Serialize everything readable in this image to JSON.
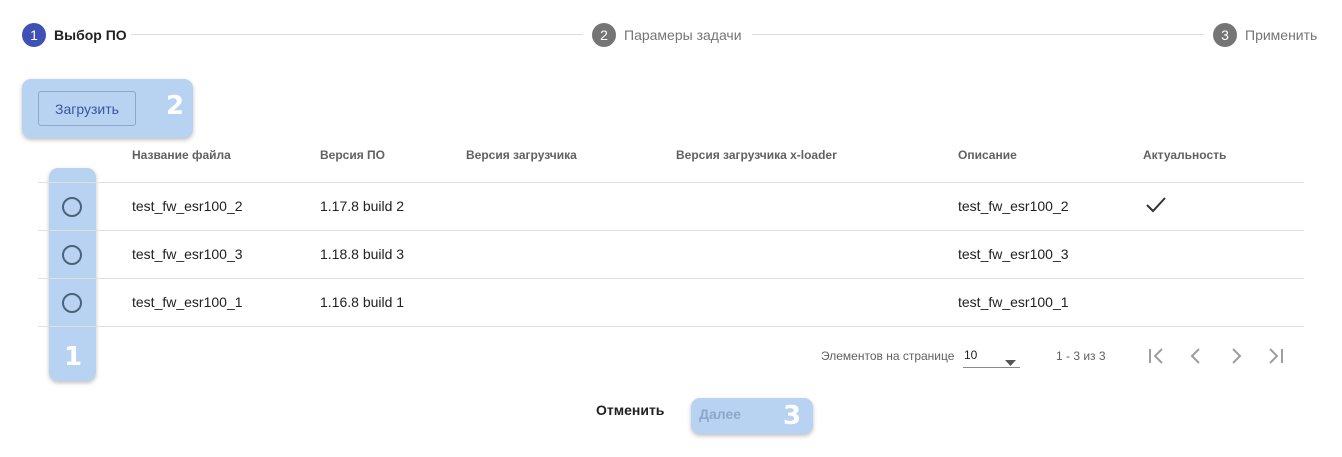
{
  "stepper": {
    "steps": [
      {
        "num": "1",
        "label": "Выбор ПО",
        "active": true
      },
      {
        "num": "2",
        "label": "Парамеры задачи",
        "active": false
      },
      {
        "num": "3",
        "label": "Применить",
        "active": false
      }
    ]
  },
  "toolbar": {
    "upload_label": "Загрузить"
  },
  "table": {
    "columns": [
      "Название файла",
      "Версия ПО",
      "Версия загрузчика",
      "Версия загрузчика x-loader",
      "Описание",
      "Актуальность"
    ],
    "rows": [
      {
        "file": "test_fw_esr100_2",
        "version": "1.17.8 build 2",
        "loader": "",
        "xloader": "",
        "description": "test_fw_esr100_2",
        "actual": true
      },
      {
        "file": "test_fw_esr100_3",
        "version": "1.18.8 build 3",
        "loader": "",
        "xloader": "",
        "description": "test_fw_esr100_3",
        "actual": false
      },
      {
        "file": "test_fw_esr100_1",
        "version": "1.16.8 build 1",
        "loader": "",
        "xloader": "",
        "description": "test_fw_esr100_1",
        "actual": false
      }
    ]
  },
  "paginator": {
    "items_per_page_label": "Элементов на странице",
    "page_size": "10",
    "range_label": "1 - 3 из 3"
  },
  "actions": {
    "cancel_label": "Отменить",
    "next_label": "Далее"
  },
  "highlights": {
    "rows_badge": "1",
    "upload_badge": "2",
    "next_badge": "3"
  },
  "colors": {
    "primary": "#3f51b5",
    "highlight": "#b8d3f1",
    "step_inactive": "#757575"
  },
  "icons": [
    "check-icon",
    "chevron-down-icon",
    "first-page-icon",
    "prev-page-icon",
    "next-page-icon",
    "last-page-icon"
  ]
}
